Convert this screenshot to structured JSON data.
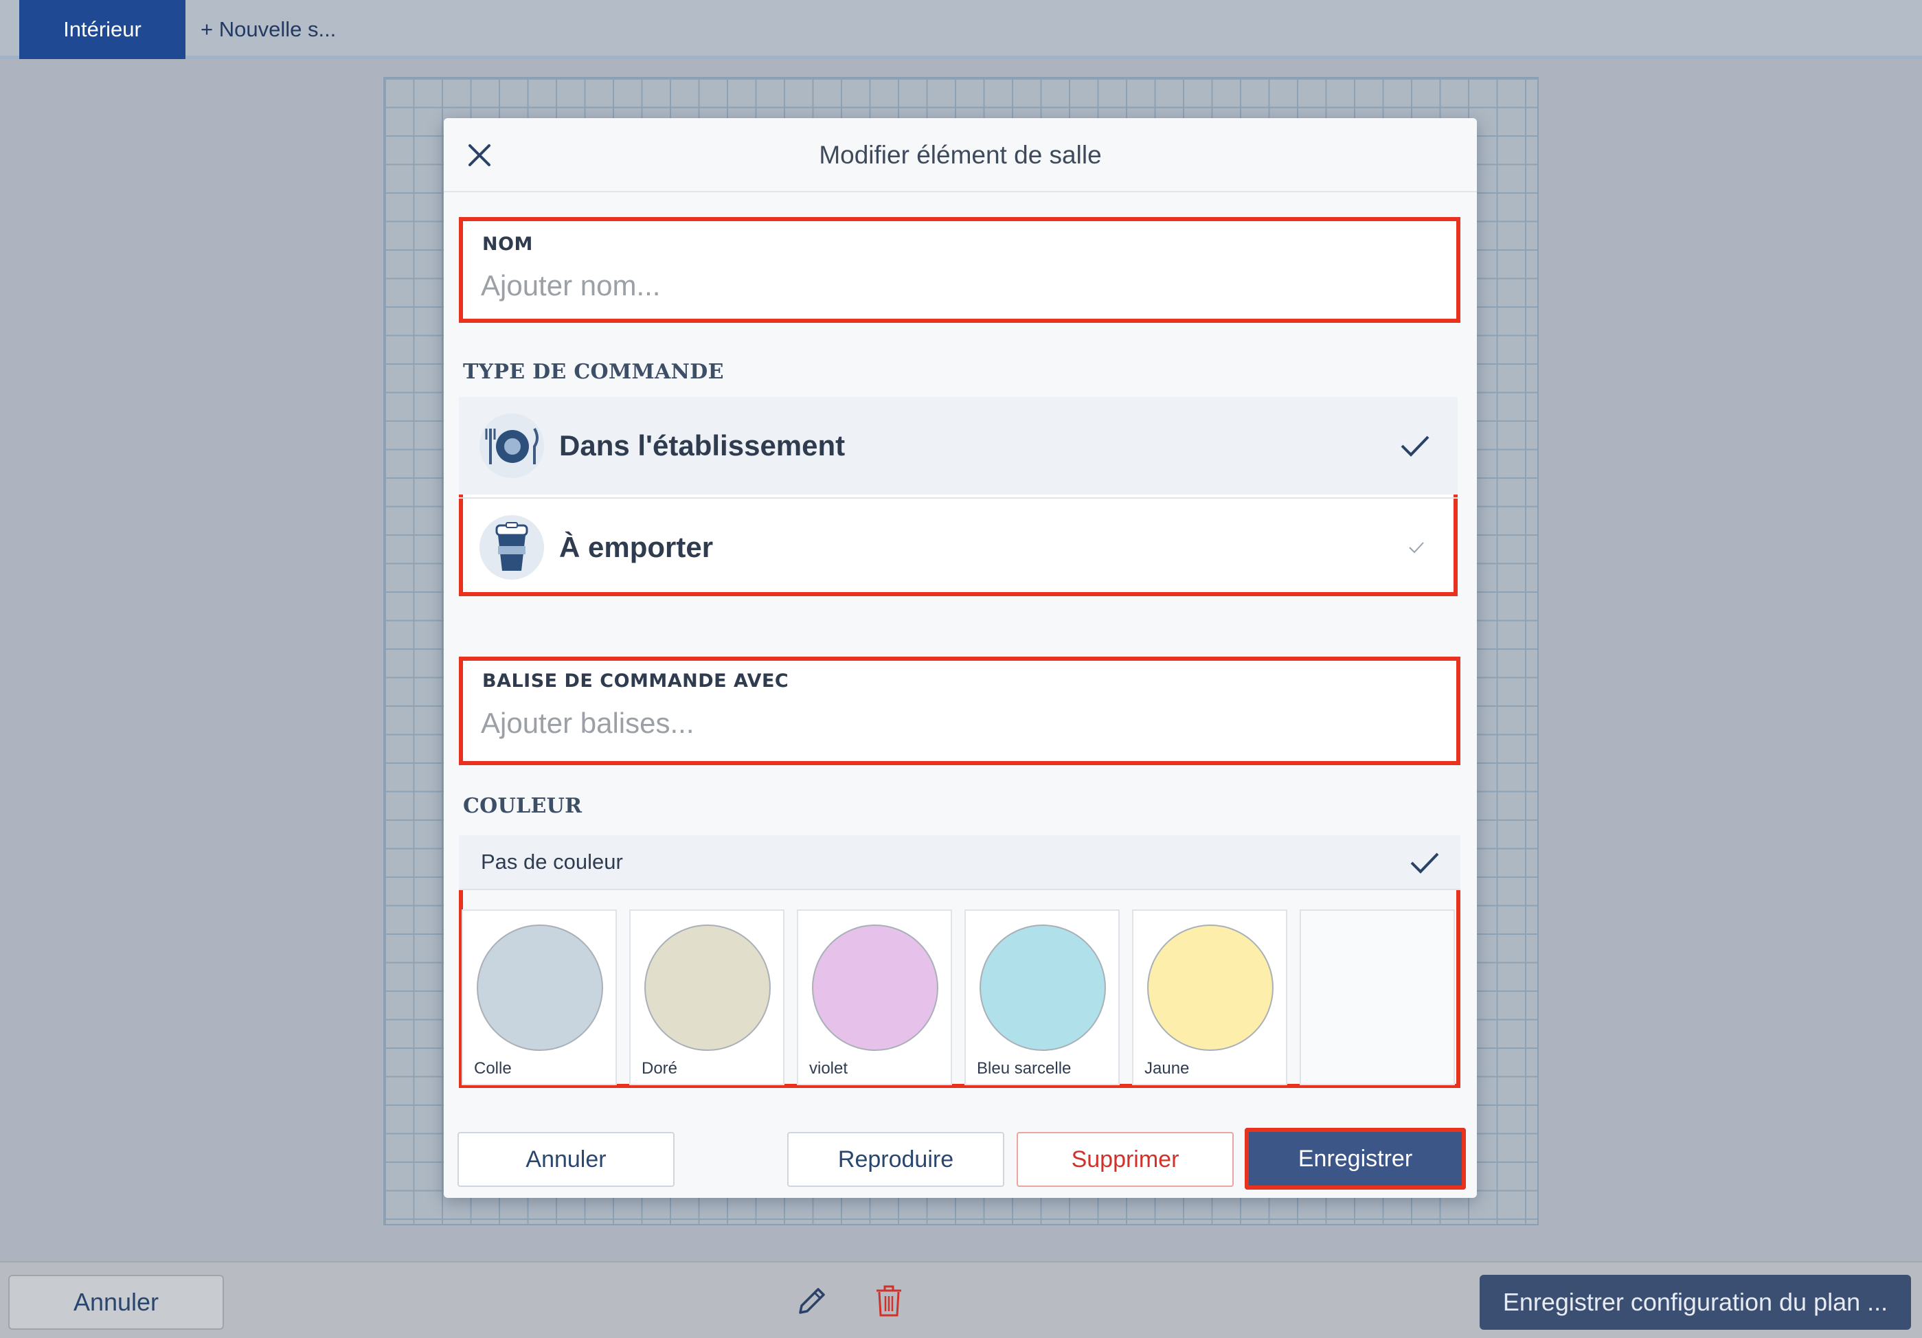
{
  "tabs": {
    "active_label": "Intérieur",
    "new_label": "+ Nouvelle s..."
  },
  "modal": {
    "title": "Modifier élément de salle",
    "name_field": {
      "label": "NOM",
      "placeholder": "Ajouter nom..."
    },
    "order_type": {
      "section_label": "TYPE DE COMMANDE",
      "options": [
        {
          "label": "Dans l'établissement",
          "icon": "plate-cutlery-icon",
          "selected": true
        },
        {
          "label": "À emporter",
          "icon": "takeaway-cup-icon",
          "selected": false
        }
      ]
    },
    "tag_field": {
      "label": "BALISE DE COMMANDE AVEC",
      "placeholder": "Ajouter balises..."
    },
    "color": {
      "section_label": "COULEUR",
      "no_color_label": "Pas de couleur",
      "no_color_selected": true,
      "swatches": [
        {
          "name": "Colle",
          "hex": "#c8d5de"
        },
        {
          "name": "Doré",
          "hex": "#e1dfcb"
        },
        {
          "name": "violet",
          "hex": "#e6c1e9"
        },
        {
          "name": "Bleu sarcelle",
          "hex": "#b0e0ea"
        },
        {
          "name": "Jaune",
          "hex": "#feeeab"
        }
      ]
    },
    "footer": {
      "cancel_label": "Annuler",
      "duplicate_label": "Reproduire",
      "delete_label": "Supprimer",
      "save_label": "Enregistrer"
    }
  },
  "bottom_bar": {
    "cancel_label": "Annuler",
    "save_plan_label": "Enregistrer configuration du plan ..."
  },
  "colors": {
    "accent": "#1f4a93",
    "primary_button": "#3c5787",
    "danger": "#d0322b",
    "highlight_outline": "#e8321e"
  }
}
